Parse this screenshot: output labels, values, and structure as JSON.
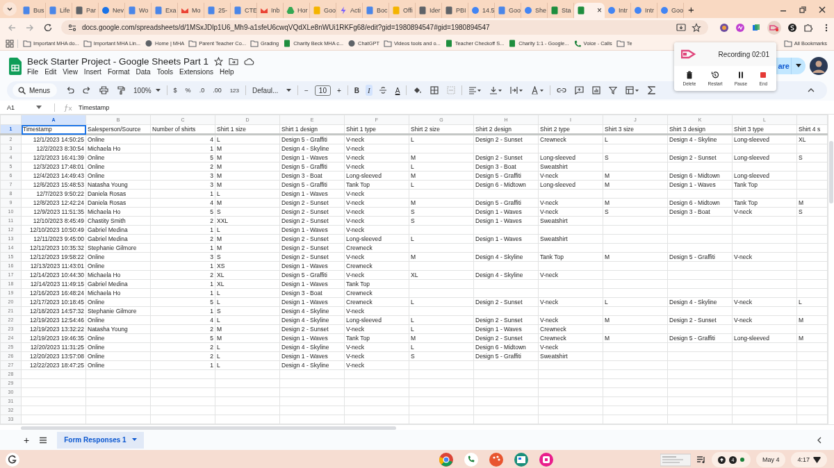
{
  "browser": {
    "tabs": [
      {
        "label": "Bus",
        "kind": "doc",
        "selected": false
      },
      {
        "label": "Life",
        "kind": "doc",
        "selected": false
      },
      {
        "label": "Par",
        "kind": "generic",
        "selected": false
      },
      {
        "label": "Nev",
        "kind": "blue",
        "selected": false
      },
      {
        "label": "Wo",
        "kind": "doc",
        "selected": false
      },
      {
        "label": "Exa",
        "kind": "doc",
        "selected": false
      },
      {
        "label": "Mo",
        "kind": "gmail",
        "selected": false
      },
      {
        "label": "25-",
        "kind": "doc",
        "selected": false
      },
      {
        "label": "CTE",
        "kind": "doc",
        "selected": false
      },
      {
        "label": "Inb",
        "kind": "gmail",
        "selected": false
      },
      {
        "label": "Hor",
        "kind": "drive",
        "selected": false
      },
      {
        "label": "Goo",
        "kind": "yellow",
        "selected": false
      },
      {
        "label": "Acti",
        "kind": "bolt",
        "selected": false
      },
      {
        "label": "Boc",
        "kind": "doc",
        "selected": false
      },
      {
        "label": "Offi",
        "kind": "yellow",
        "selected": false
      },
      {
        "label": "Ider",
        "kind": "generic",
        "selected": false
      },
      {
        "label": "PBI",
        "kind": "generic",
        "selected": false
      },
      {
        "label": "14.5",
        "kind": "google",
        "selected": false
      },
      {
        "label": "Goo",
        "kind": "doc",
        "selected": false
      },
      {
        "label": "She",
        "kind": "google",
        "selected": false
      },
      {
        "label": "Sta",
        "kind": "sheet",
        "selected": false
      },
      {
        "kind": "sheet",
        "selected": true,
        "close": "×"
      },
      {
        "label": "Intr",
        "kind": "google",
        "selected": false
      },
      {
        "label": "Intr",
        "kind": "google",
        "selected": false
      },
      {
        "label": "Goo",
        "kind": "google",
        "selected": false
      }
    ],
    "new_tab": "+",
    "address": "docs.google.com/spreadsheets/d/1MSxJDlp1U6_Mh9-a1sfeU6cwqVQdXLe8nWUi1RKFg68/edit?gid=1980894547#gid=1980894547",
    "bookmarks": [
      {
        "label": "Important MHA do...",
        "kind": "folder"
      },
      {
        "label": "Important MHA Lin...",
        "kind": "folder"
      },
      {
        "label": "Home | MHA",
        "kind": "site"
      },
      {
        "label": "Parent Teacher Co...",
        "kind": "folder"
      },
      {
        "label": "Grading",
        "kind": "folder"
      },
      {
        "label": "Charity Beck MHA c...",
        "kind": "sheet"
      },
      {
        "label": "ChatGPT",
        "kind": "site"
      },
      {
        "label": "Videos tools and o...",
        "kind": "folder"
      },
      {
        "label": "Teacher Checkoff S...",
        "kind": "sheet"
      },
      {
        "label": "Charity 1:1 - Google...",
        "kind": "sheet"
      },
      {
        "label": "Voice - Calls",
        "kind": "voice"
      },
      {
        "label": "Te",
        "kind": "folder"
      }
    ],
    "all_bookmarks": "All Bookmarks"
  },
  "doc": {
    "title": "Beck Starter Project - Google Sheets Part 1",
    "menus": [
      "File",
      "Edit",
      "View",
      "Insert",
      "Format",
      "Data",
      "Tools",
      "Extensions",
      "Help"
    ],
    "share": "are"
  },
  "toolbar": {
    "search": "Menus",
    "zoom": "100%",
    "currency": "$",
    "percent": "%",
    "decrease_decimals": ".0",
    "increase_decimals": ".00",
    "number_format": "123",
    "font": "Defaul...",
    "minus": "−",
    "font_size": "10",
    "plus": "+",
    "bold": {
      "label": "B",
      "on": false
    },
    "italic": {
      "label": "I",
      "on": true
    },
    "text_color": "A"
  },
  "formula_bar": {
    "cell": "A1",
    "content": "Timestamp"
  },
  "sheet": {
    "columns": [
      {
        "letter": "A",
        "selected": true,
        "numeric": true
      },
      {
        "letter": "B",
        "selected": false,
        "numeric": false
      },
      {
        "letter": "C",
        "selected": false,
        "numeric": true
      },
      {
        "letter": "D",
        "selected": false,
        "numeric": false
      },
      {
        "letter": "E",
        "selected": false,
        "numeric": false
      },
      {
        "letter": "F",
        "selected": false,
        "numeric": false
      },
      {
        "letter": "G",
        "selected": false,
        "numeric": false
      },
      {
        "letter": "H",
        "selected": false,
        "numeric": false
      },
      {
        "letter": "I",
        "selected": false,
        "numeric": false
      },
      {
        "letter": "J",
        "selected": false,
        "numeric": false
      },
      {
        "letter": "K",
        "selected": false,
        "numeric": false
      },
      {
        "letter": "L",
        "selected": false,
        "numeric": false
      },
      {
        "selected": false,
        "numeric": false
      }
    ],
    "rows": [
      {
        "number": "1",
        "selected": true,
        "cells": [
          "Timestamp",
          "Salesperson/Source",
          "Number of shirts",
          "Shirt 1 size",
          "Shirt 1 design",
          "Shirt 1 type",
          "Shirt 2 size",
          "Shirt 2 design",
          "Shirt 2 type",
          "Shirt 3 size",
          "Shirt 3 design",
          "Shirt 3 type",
          "Shirt 4 s"
        ]
      },
      {
        "number": "2",
        "selected": false,
        "cells": [
          "12/1/2023 14:50:25",
          "Online",
          "4",
          "L",
          "Design 5 - Graffiti",
          "V-neck",
          "L",
          "Design 2 - Sunset",
          "Crewneck",
          "L",
          "Design 4 - Skyline",
          "Long-sleeved",
          "XL"
        ]
      },
      {
        "number": "3",
        "selected": false,
        "cells": [
          "12/2/2023 8:30:54",
          "Michaela Ho",
          "1",
          "M",
          "Design 4 - Skyline",
          "V-neck"
        ]
      },
      {
        "number": "4",
        "selected": false,
        "cells": [
          "12/2/2023 16:41:39",
          "Online",
          "5",
          "M",
          "Design 1 - Waves",
          "V-neck",
          "M",
          "Design 2 - Sunset",
          "Long-sleeved",
          "S",
          "Design 2 - Sunset",
          "Long-sleeved",
          "S"
        ]
      },
      {
        "number": "5",
        "selected": false,
        "cells": [
          "12/3/2023 17:48:01",
          "Online",
          "2",
          "M",
          "Design 5 - Graffiti",
          "V-neck",
          "L",
          "Design 3 - Boat",
          "Sweatshirt"
        ]
      },
      {
        "number": "6",
        "selected": false,
        "cells": [
          "12/4/2023 14:49:43",
          "Online",
          "3",
          "M",
          "Design 3 - Boat",
          "Long-sleeved",
          "M",
          "Design 5 - Graffiti",
          "V-neck",
          "M",
          "Design 6 - Midtown",
          "Long-sleeved"
        ]
      },
      {
        "number": "7",
        "selected": false,
        "cells": [
          "12/6/2023 15:48:53",
          "Natasha Young",
          "3",
          "M",
          "Design 5 - Graffiti",
          "Tank Top",
          "L",
          "Design 6 - Midtown",
          "Long-sleeved",
          "M",
          "Design 1 - Waves",
          "Tank Top"
        ]
      },
      {
        "number": "8",
        "selected": false,
        "cells": [
          "12/7/2023 9:50:22",
          "Daniela Rosas",
          "1",
          "L",
          "Design 1 - Waves",
          "V-neck"
        ]
      },
      {
        "number": "9",
        "selected": false,
        "cells": [
          "12/8/2023 12:42:24",
          "Daniela Rosas",
          "4",
          "M",
          "Design 2 - Sunset",
          "V-neck",
          "M",
          "Design 5 - Graffiti",
          "V-neck",
          "M",
          "Design 6 - Midtown",
          "Tank Top",
          "M"
        ]
      },
      {
        "number": "10",
        "selected": false,
        "cells": [
          "12/9/2023 11:51:35",
          "Michaela Ho",
          "5",
          "S",
          "Design 2 - Sunset",
          "V-neck",
          "S",
          "Design 1 - Waves",
          "V-neck",
          "S",
          "Design 3 - Boat",
          "V-neck",
          "S"
        ]
      },
      {
        "number": "11",
        "selected": false,
        "cells": [
          "12/10/2023 8:45:49",
          "Chastity Smith",
          "2",
          "XXL",
          "Design 2 - Sunset",
          "V-neck",
          "S",
          "Design 1 - Waves",
          "Sweatshirt"
        ]
      },
      {
        "number": "12",
        "selected": false,
        "cells": [
          "12/10/2023 10:50:49",
          "Gabriel Medina",
          "1",
          "L",
          "Design 1 - Waves",
          "V-neck"
        ]
      },
      {
        "number": "13",
        "selected": false,
        "cells": [
          "12/11/2023 9:45:00",
          "Gabriel Medina",
          "2",
          "M",
          "Design 2 - Sunset",
          "Long-sleeved",
          "L",
          "Design 1 - Waves",
          "Sweatshirt"
        ]
      },
      {
        "number": "14",
        "selected": false,
        "cells": [
          "12/12/2023 10:35:32",
          "Stephanie Gilmore",
          "1",
          "M",
          "Design 2 - Sunset",
          "Crewneck"
        ]
      },
      {
        "number": "15",
        "selected": false,
        "cells": [
          "12/12/2023 19:58:22",
          "Online",
          "3",
          "S",
          "Design 2 - Sunset",
          "V-neck",
          "M",
          "Design 4 - Skyline",
          "Tank Top",
          "M",
          "Design 5 - Graffiti",
          "V-neck"
        ]
      },
      {
        "number": "16",
        "selected": false,
        "cells": [
          "12/13/2023 11:43:01",
          "Online",
          "1",
          "XS",
          "Design 1 - Waves",
          "Crewneck"
        ]
      },
      {
        "number": "17",
        "selected": false,
        "cells": [
          "12/14/2023 10:44:30",
          "Michaela Ho",
          "2",
          "XL",
          "Design 5 - Graffiti",
          "V-neck",
          "XL",
          "Design 4 - Skyline",
          "V-neck"
        ]
      },
      {
        "number": "18",
        "selected": false,
        "cells": [
          "12/14/2023 11:49:15",
          "Gabriel Medina",
          "1",
          "XL",
          "Design 1 - Waves",
          "Tank Top"
        ]
      },
      {
        "number": "19",
        "selected": false,
        "cells": [
          "12/16/2023 16:48:24",
          "Michaela Ho",
          "1",
          "L",
          "Design 3 - Boat",
          "Crewneck"
        ]
      },
      {
        "number": "20",
        "selected": false,
        "cells": [
          "12/17/2023 10:18:45",
          "Online",
          "5",
          "L",
          "Design 1 - Waves",
          "Crewneck",
          "L",
          "Design 2 - Sunset",
          "V-neck",
          "L",
          "Design 4 - Skyline",
          "V-neck",
          "L"
        ]
      },
      {
        "number": "21",
        "selected": false,
        "cells": [
          "12/18/2023 14:57:32",
          "Stephanie Gilmore",
          "1",
          "S",
          "Design 4 - Skyline",
          "V-neck"
        ]
      },
      {
        "number": "22",
        "selected": false,
        "cells": [
          "12/19/2023 12:54:46",
          "Online",
          "4",
          "L",
          "Design 4 - Skyline",
          "Long-sleeved",
          "L",
          "Design 2 - Sunset",
          "V-neck",
          "M",
          "Design 2 - Sunset",
          "V-neck",
          "M"
        ]
      },
      {
        "number": "23",
        "selected": false,
        "cells": [
          "12/19/2023 13:32:22",
          "Natasha Young",
          "2",
          "M",
          "Design 2 - Sunset",
          "V-neck",
          "L",
          "Design 1 - Waves",
          "Crewneck"
        ]
      },
      {
        "number": "24",
        "selected": false,
        "cells": [
          "12/19/2023 19:46:35",
          "Online",
          "5",
          "M",
          "Design 1 - Waves",
          "Tank Top",
          "M",
          "Design 2 - Sunset",
          "Crewneck",
          "M",
          "Design 5 - Graffiti",
          "Long-sleeved",
          "M"
        ]
      },
      {
        "number": "25",
        "selected": false,
        "cells": [
          "12/20/2023 11:31:25",
          "Online",
          "2",
          "L",
          "Design 4 - Skyline",
          "V-neck",
          "L",
          "Design 6 - Midtown",
          "V-neck"
        ]
      },
      {
        "number": "26",
        "selected": false,
        "cells": [
          "12/20/2023 13:57:08",
          "Online",
          "2",
          "L",
          "Design 1 - Waves",
          "V-neck",
          "S",
          "Design 5 - Graffiti",
          "Sweatshirt"
        ]
      },
      {
        "number": "27",
        "selected": false,
        "cells": [
          "12/22/2023 18:47:25",
          "Online",
          "1",
          "L",
          "Design 4 - Skyline",
          "V-neck"
        ]
      },
      {
        "number": "28",
        "selected": false,
        "cells": []
      },
      {
        "number": "29",
        "selected": false,
        "cells": []
      },
      {
        "number": "30",
        "selected": false,
        "cells": []
      },
      {
        "number": "31",
        "selected": false,
        "cells": []
      },
      {
        "number": "32",
        "selected": false,
        "cells": []
      },
      {
        "number": "33",
        "selected": false,
        "cells": []
      }
    ]
  },
  "sheet_tabs": {
    "add": "+",
    "tabs": [
      {
        "label": "Form Responses 1",
        "selected": true
      }
    ]
  },
  "recorder": {
    "status": "Recording 02:01",
    "actions": [
      {
        "label": "Delete",
        "kind": "delete"
      },
      {
        "label": "Restart",
        "kind": "restart"
      },
      {
        "label": "Pause",
        "kind": "pause"
      },
      {
        "label": "End",
        "kind": "end"
      }
    ]
  },
  "shelf": {
    "notification_count": "4",
    "date": "May 4",
    "time": "4:17"
  }
}
